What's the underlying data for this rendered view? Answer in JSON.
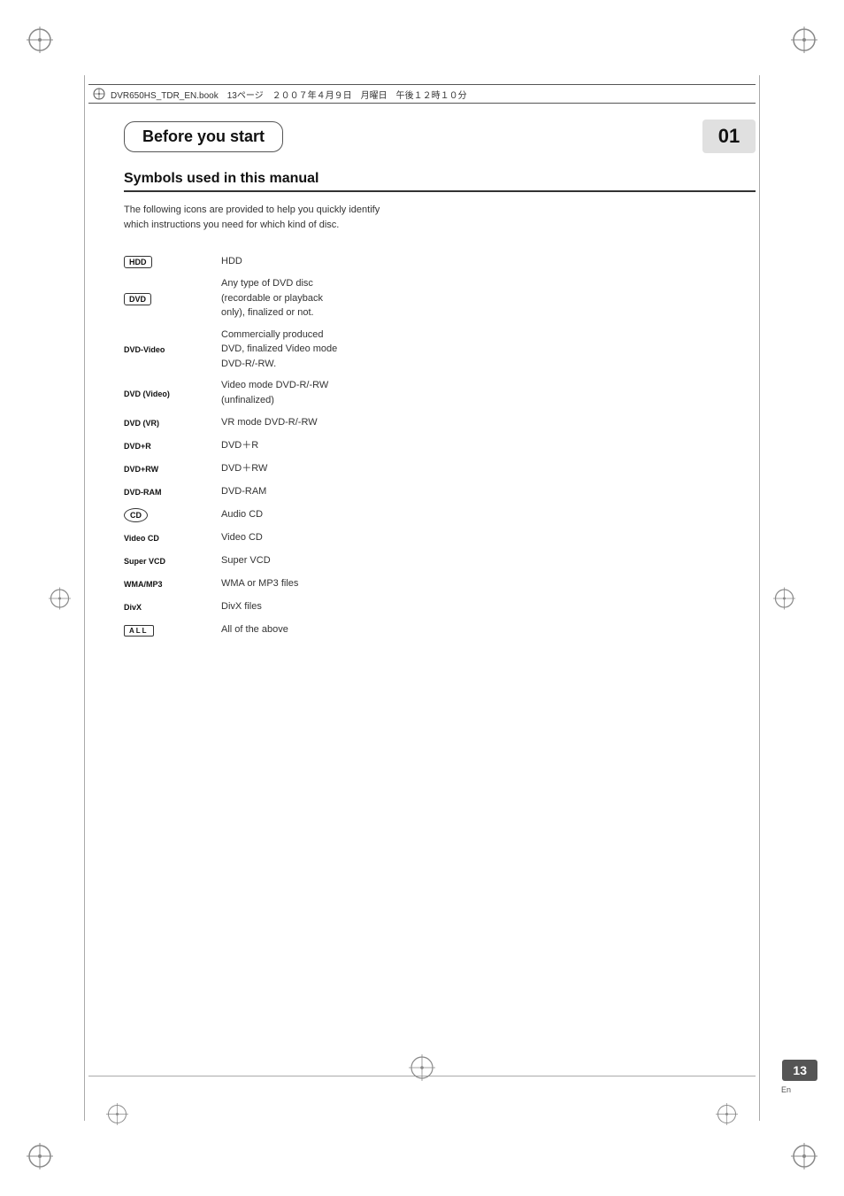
{
  "page": {
    "title": "Before you start",
    "section_number": "01",
    "page_number": "13",
    "page_lang": "En",
    "metadata_bar": "DVR650HS_TDR_EN.book　13ページ　２００７年４月９日　月曜日　午後１２時１０分"
  },
  "subsection": {
    "title": "Symbols used in this manual"
  },
  "intro": {
    "text": "The following icons are provided to help you quickly identify which instructions you need for which kind of disc."
  },
  "symbols": [
    {
      "badge": "HDD",
      "badge_type": "rect",
      "description": "HDD"
    },
    {
      "badge": "DVD",
      "badge_type": "rect",
      "description": "Any type of DVD disc\n(recordable or playback\nonly), finalized or not."
    },
    {
      "badge": "DVD-Video",
      "badge_type": "text",
      "description": "Commercially produced\nDVD, finalized Video mode\nDVD-R/-RW."
    },
    {
      "badge": "DVD (Video)",
      "badge_type": "text",
      "description": "Video mode DVD-R/-RW\n(unfinalized)"
    },
    {
      "badge": "DVD (VR)",
      "badge_type": "text",
      "description": "VR mode DVD-R/-RW"
    },
    {
      "badge": "DVD+R",
      "badge_type": "text",
      "description": "DVD＋R"
    },
    {
      "badge": "DVD+RW",
      "badge_type": "text",
      "description": "DVD＋RW"
    },
    {
      "badge": "DVD-RAM",
      "badge_type": "text",
      "description": "DVD-RAM"
    },
    {
      "badge": "CD",
      "badge_type": "circle",
      "description": "Audio CD"
    },
    {
      "badge": "Video CD",
      "badge_type": "text",
      "description": "Video CD"
    },
    {
      "badge": "Super VCD",
      "badge_type": "text",
      "description": "Super VCD"
    },
    {
      "badge": "WMA/MP3",
      "badge_type": "text",
      "description": "WMA or MP3 files"
    },
    {
      "badge": "DivX",
      "badge_type": "text",
      "description": "DivX files"
    },
    {
      "badge": "ALL",
      "badge_type": "outline",
      "description": "All of the above"
    }
  ]
}
